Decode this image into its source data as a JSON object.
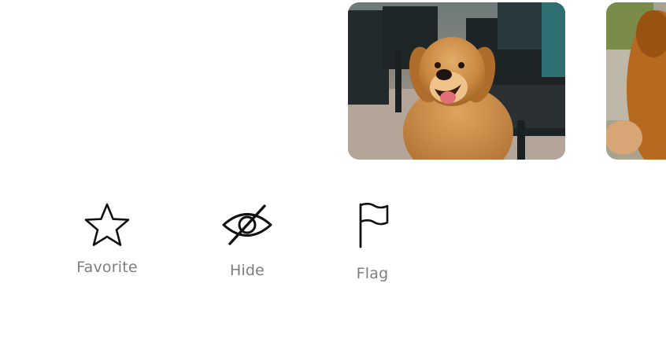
{
  "photos": [
    {
      "alt": "golden retriever smiling on patio"
    },
    {
      "alt": "golden retriever partially visible"
    }
  ],
  "actions": {
    "favorite": {
      "label": "Favorite",
      "icon": "star-icon"
    },
    "hide": {
      "label": "Hide",
      "icon": "eye-slash-icon"
    },
    "flag": {
      "label": "Flag",
      "icon": "flag-icon"
    }
  },
  "colors": {
    "label": "#7d7d7d",
    "icon": "#111111",
    "background": "#ffffff"
  }
}
